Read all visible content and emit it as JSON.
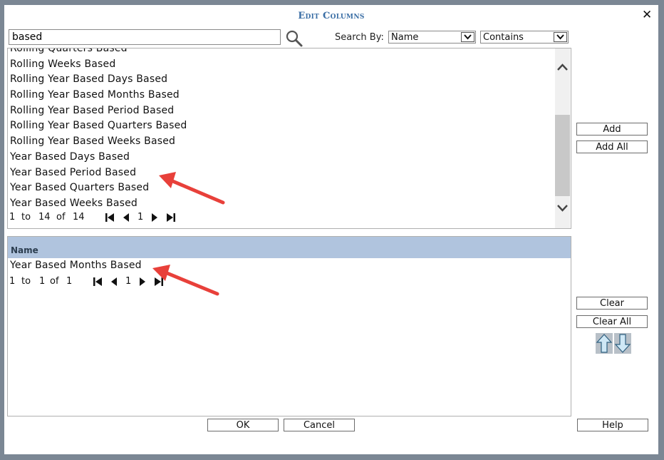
{
  "dialog": {
    "title": "Edit Columns",
    "close_glyph": "✕"
  },
  "search": {
    "query": "based",
    "search_by_label": "Search By:",
    "field_value": "Name",
    "match_value": "Contains"
  },
  "available": {
    "items": [
      "Rolling Quarters Based",
      "Rolling Weeks Based",
      "Rolling Year Based Days Based",
      "Rolling Year Based Months Based",
      "Rolling Year Based Period Based",
      "Rolling Year Based Quarters Based",
      "Rolling Year Based Weeks Based",
      "Year Based Days Based",
      "Year Based Period Based",
      "Year Based Quarters Based",
      "Year Based Weeks Based"
    ],
    "pager": {
      "from": "1",
      "to_label": "to",
      "to": "14",
      "of_label": "of",
      "total": "14",
      "page": "1"
    }
  },
  "selected": {
    "header": "Name",
    "items": [
      "Year Based Months Based"
    ],
    "pager": {
      "from": "1",
      "to_label": "to",
      "to": "1",
      "of_label": "of",
      "total": "1",
      "page": "1"
    }
  },
  "buttons": {
    "add": "Add",
    "add_all": "Add All",
    "clear": "Clear",
    "clear_all": "Clear All",
    "ok": "OK",
    "cancel": "Cancel",
    "help": "Help"
  },
  "icons": {
    "search": "search-icon",
    "scroll_up": "chevron-up-icon",
    "scroll_down": "chevron-down-icon",
    "first": "first-page-icon",
    "prev": "prev-page-icon",
    "next": "next-page-icon",
    "last": "last-page-icon",
    "move_up": "move-up-arrow-icon",
    "move_down": "move-down-arrow-icon"
  },
  "colors": {
    "title": "#3a6ea5",
    "header_bg": "#b0c4de",
    "annotation_arrow": "#e8403a",
    "outer_frame": "#7b8794"
  }
}
